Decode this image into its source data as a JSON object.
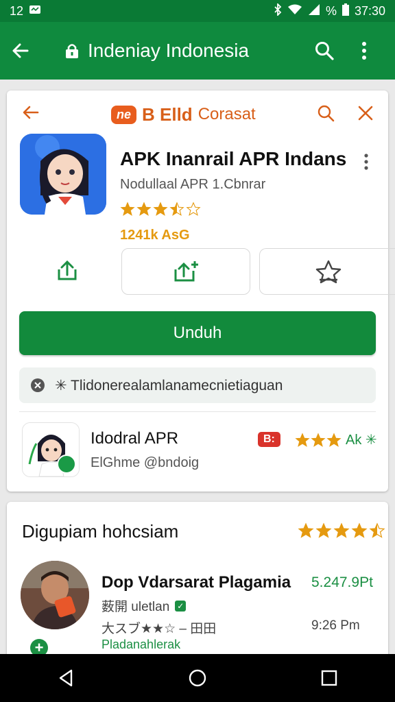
{
  "status_bar": {
    "time_left": "12",
    "battery_text": "%",
    "clock": "37:30"
  },
  "app_bar": {
    "title": "Indeniay Indonesia",
    "icons": [
      "back-arrow-icon",
      "lock-icon",
      "search-icon",
      "more-vert-icon"
    ]
  },
  "store_header": {
    "brand_badge": "ne",
    "brand_name": "B Elld",
    "brand_suffix": "Corasat",
    "icons": [
      "back-arrow-icon",
      "search-icon",
      "close-icon"
    ],
    "accent_color": "#d85f19"
  },
  "app": {
    "title": "APK Inanrail APR Indans",
    "subtitle": "Nodullaal APR 1.Cbnrar",
    "rating_stars": 3.5,
    "downloads": "1241k AsG",
    "actions": [
      "share-icon",
      "share-plus-icon",
      "star-outline-icon"
    ],
    "download_label": "Unduh",
    "notice_text": "✳ Tlidonerealamlanamecnietiaguan"
  },
  "related": {
    "title": "Idodral APR",
    "subtitle": "ElGhme @bndoig",
    "tag": "B:",
    "rating_stars": 3,
    "rating_text": "Ak ✳"
  },
  "reviews": {
    "section_title": "Digupiam hohcsiam",
    "section_stars": 4.5,
    "reviewer": {
      "name": "Dop Vdarsarat Plagamia",
      "price": "5.247.9Pt",
      "meta": "薮開 uletlan",
      "stars_text": "大スブ★★☆ – 田田",
      "time": "9:26 Pm",
      "link": "Pladanahlerak"
    }
  },
  "colors": {
    "primary_green": "#0f8a3e",
    "status_green": "#0a7a35",
    "button_green": "#128a3c",
    "star_orange": "#e59a10"
  }
}
